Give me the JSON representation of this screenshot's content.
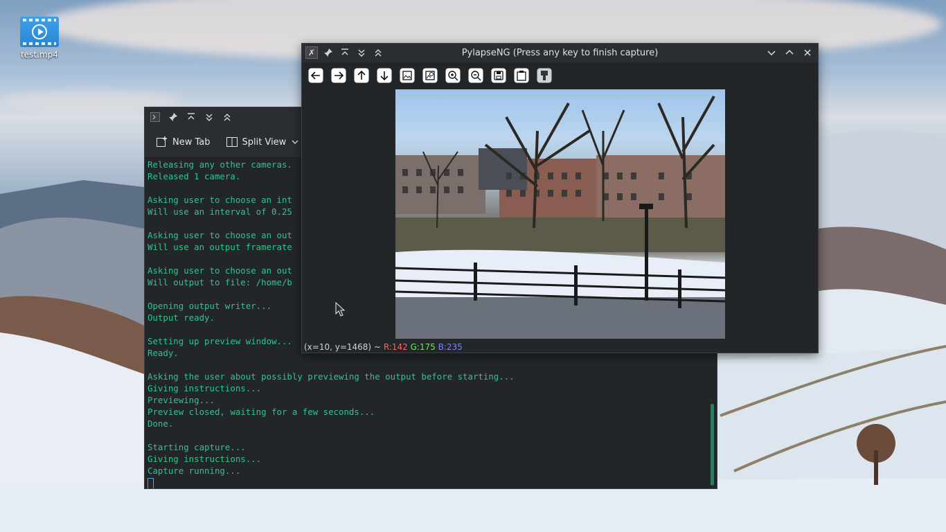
{
  "desktop": {
    "icon_label": "test.mp4"
  },
  "terminal": {
    "toolbar": {
      "new_tab": "New Tab",
      "split_view": "Split View"
    },
    "lines": [
      "Releasing any other cameras.",
      "Released 1 camera.",
      "",
      "Asking user to choose an int",
      "Will use an interval of 0.25",
      "",
      "Asking user to choose an out",
      "Will use an output framerate",
      "",
      "Asking user to choose an out",
      "Will output to file: /home/b",
      "",
      "Opening output writer...",
      "Output ready.",
      "",
      "Setting up preview window...",
      "Ready.",
      "",
      "Asking the user about possibly previewing the output before starting...",
      "Giving instructions...",
      "Previewing...",
      "Preview closed, waiting for a few seconds...",
      "Done.",
      "",
      "Starting capture...",
      "Giving instructions...",
      "Capture running..."
    ]
  },
  "viewer": {
    "title": "PylapseNG (Press any key to finish capture)",
    "status": {
      "coords": "(x=10, y=1468) ~",
      "r": "R:142",
      "g": "G:175",
      "b": "B:235"
    }
  },
  "colors": {
    "terminal_text": "#2fc48d",
    "accent": "#3daee9"
  }
}
